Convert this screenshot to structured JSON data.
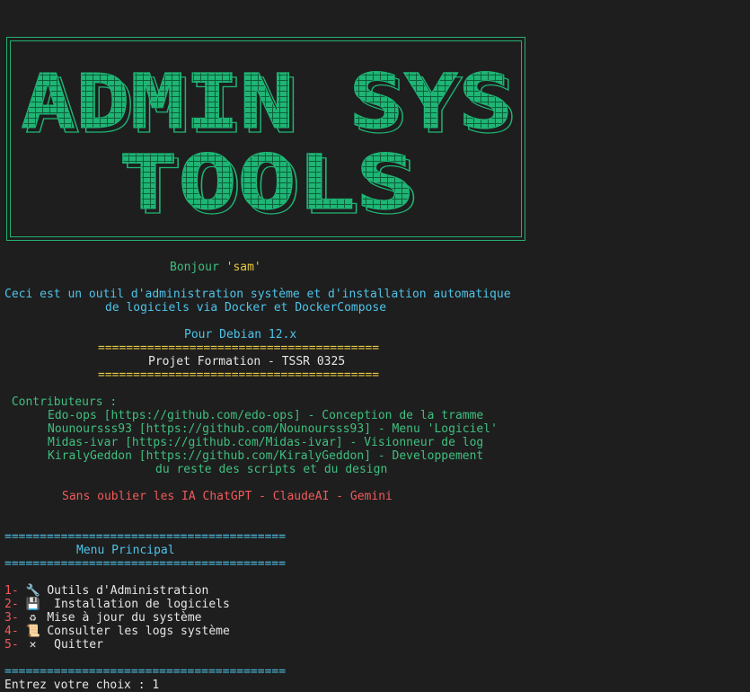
{
  "banner": {
    "line1": "ADMIN SYS",
    "line2": "TOOLS",
    "color": "#1fb575"
  },
  "greeting": {
    "prefix": "Bonjour ",
    "user": "'sam'"
  },
  "description": {
    "line1": "Ceci est un outil d'administration système et d'installation automatique",
    "line2": "de logiciels via Docker et DockerCompose"
  },
  "target": "Pour Debian 12.x",
  "project": {
    "separator": "========================================",
    "title": "Projet Formation - TSSR 0325"
  },
  "contributors": {
    "heading": " Contributeurs :",
    "items": [
      "Edo-ops [https://github.com/edo-ops] - Conception de la tramme",
      "Nounoursss93 [https://github.com/Nounoursss93] - Menu 'Logiciel'",
      "Midas-ivar [https://github.com/Midas-ivar] - Visionneur de log",
      "KiralyGeddon [https://github.com/KiralyGeddon] - Developpement"
    ],
    "continuation": "du reste des scripts et du design"
  },
  "thanks": "Sans oublier les IA ChatGPT - ClaudeAI - Gemini",
  "menu": {
    "separator": "========================================",
    "title": "Menu Principal",
    "items": [
      {
        "num": "1-",
        "icon": "🔧",
        "label": "Outils d'Administration"
      },
      {
        "num": "2-",
        "icon": "💾",
        "label": " Installation de logiciels"
      },
      {
        "num": "3-",
        "icon": "♻",
        "label": "Mise à jour du système"
      },
      {
        "num": "4-",
        "icon": "📜",
        "label": "Consulter les logs système"
      },
      {
        "num": "5-",
        "icon": "✕",
        "label": " Quitter"
      }
    ]
  },
  "prompt": {
    "text": "Entrez votre choix : ",
    "value": "1"
  }
}
